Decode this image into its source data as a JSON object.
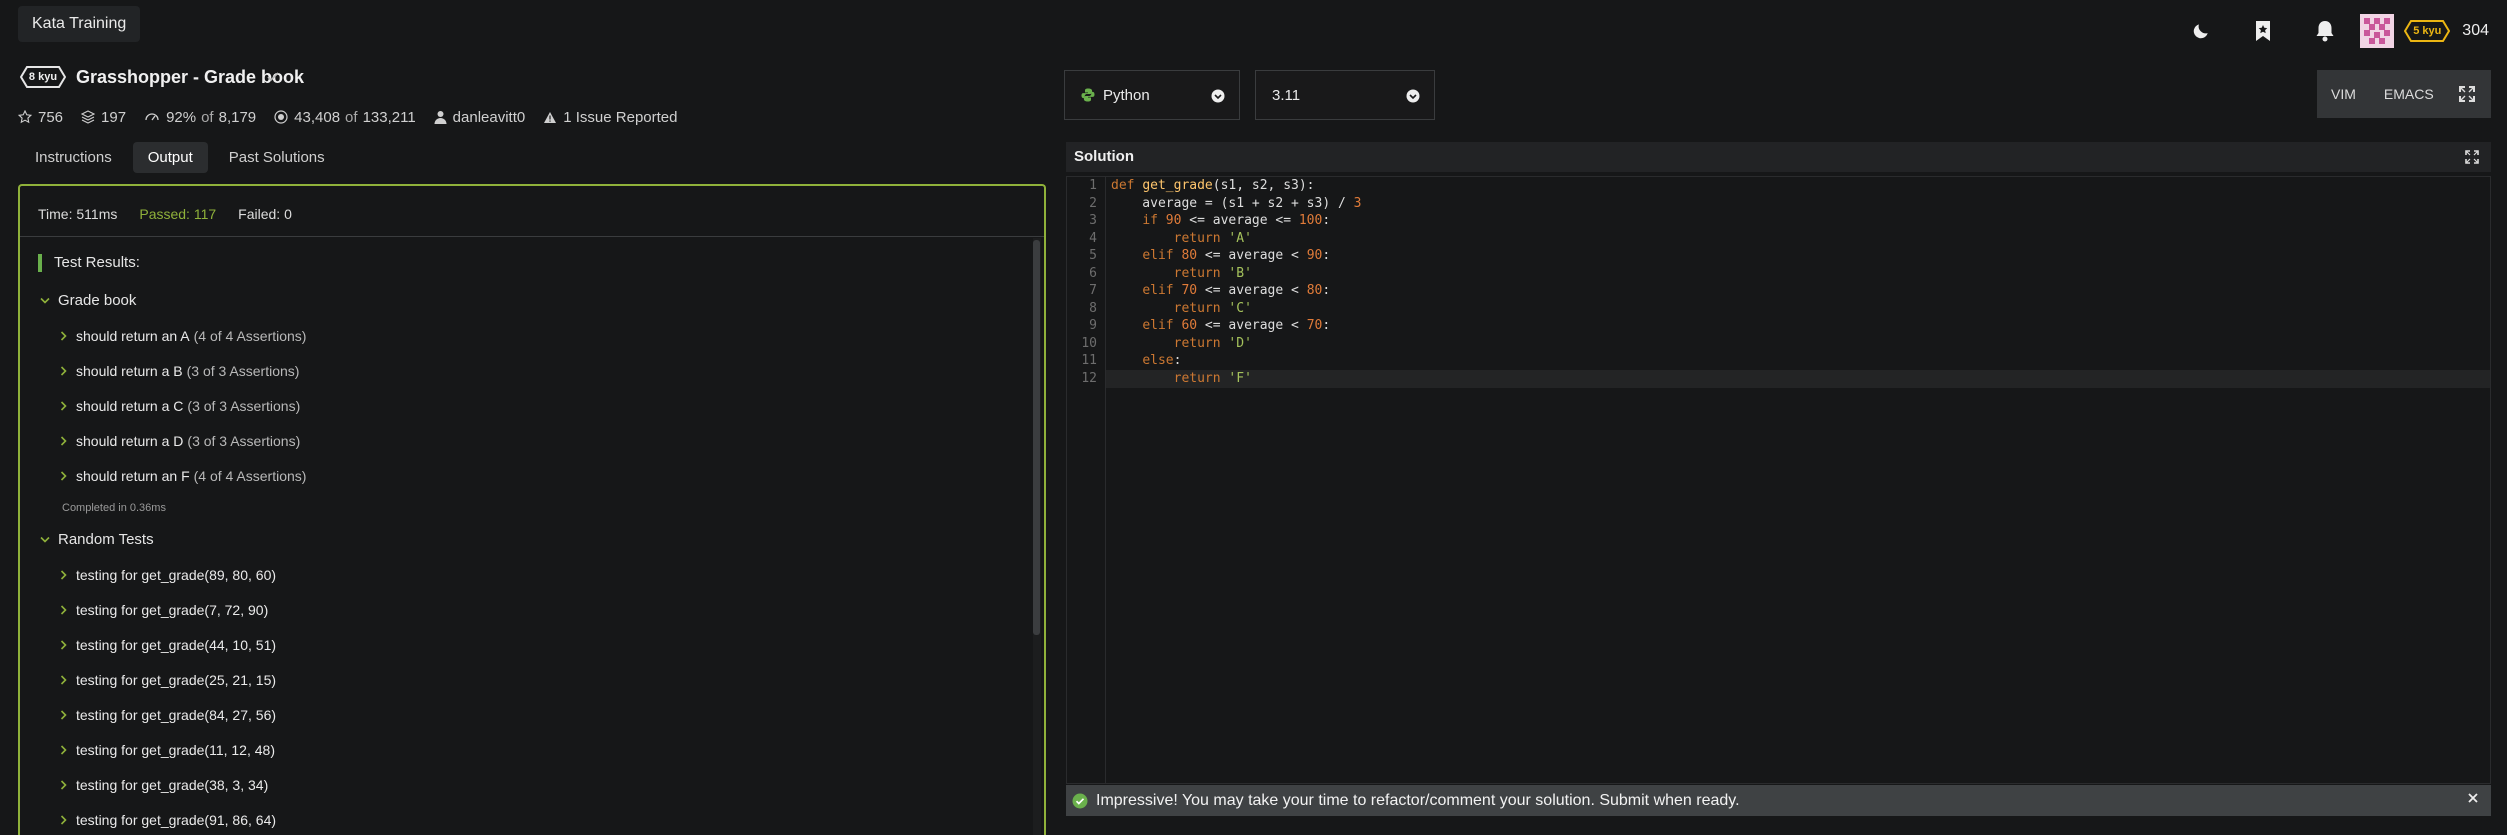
{
  "topbar": {
    "brand": "Kata Training",
    "rank": "5 kyu",
    "honor": "304",
    "colors": {
      "rank_badge": "#ecb613"
    }
  },
  "kata": {
    "kyu": "8 kyu",
    "title": "Grasshopper - Grade book",
    "stats": {
      "stars": "756",
      "collections": "197",
      "satisfaction": "92%",
      "of": "of",
      "votes": "8,179",
      "completed": "43,408",
      "attempts": "133,211",
      "author": "danleavitt0",
      "issues": "1 Issue Reported"
    }
  },
  "tabs": [
    {
      "label": "Instructions"
    },
    {
      "label": "Output"
    },
    {
      "label": "Past Solutions"
    }
  ],
  "output": {
    "time": "Time: 511ms",
    "passed": "Passed: 117",
    "failed": "Failed: 0",
    "results_heading": "Test Results:",
    "group1": {
      "title": "Grade book",
      "tests": [
        {
          "name": "should return an A",
          "assertions": "(4 of 4 Assertions)"
        },
        {
          "name": "should return a B",
          "assertions": "(3 of 3 Assertions)"
        },
        {
          "name": "should return a C",
          "assertions": "(3 of 3 Assertions)"
        },
        {
          "name": "should return a D",
          "assertions": "(3 of 3 Assertions)"
        },
        {
          "name": "should return an F",
          "assertions": "(4 of 4 Assertions)"
        }
      ],
      "completed": "Completed in 0.36ms"
    },
    "group2": {
      "title": "Random Tests",
      "tests": [
        "testing for get_grade(89, 80, 60)",
        "testing for get_grade(7, 72, 90)",
        "testing for get_grade(44, 10, 51)",
        "testing for get_grade(25, 21, 15)",
        "testing for get_grade(84, 27, 56)",
        "testing for get_grade(11, 12, 48)",
        "testing for get_grade(38, 3, 34)",
        "testing for get_grade(91, 86, 64)"
      ]
    }
  },
  "editor": {
    "language": "Python",
    "version": "3.11",
    "modes": [
      "VIM",
      "EMACS"
    ],
    "solution_title": "Solution",
    "line_numbers": [
      "1",
      "2",
      "3",
      "4",
      "5",
      "6",
      "7",
      "8",
      "9",
      "10",
      "11",
      "12"
    ],
    "code": {
      "l1_kw": "def",
      "l1_fn": "get_grade",
      "l1_rest": "(s1, s2, s3):",
      "l2": "    average = (s1 + s2 + s3) / ",
      "l2_num": "3",
      "l3_kw": "if",
      "l3_num": "90",
      "l3_rest": " <= average <= ",
      "l3_num2": "100",
      "l3_end": ":",
      "l4_kw": "return",
      "l4_str": "'A'",
      "l5_kw": "elif",
      "l5_num": "80",
      "l5_rest": " <= average < ",
      "l5_num2": "90",
      "l5_end": ":",
      "l6_kw": "return",
      "l6_str": "'B'",
      "l7_kw": "elif",
      "l7_num": "70",
      "l7_rest": " <= average < ",
      "l7_num2": "80",
      "l7_end": ":",
      "l8_kw": "return",
      "l8_str": "'C'",
      "l9_kw": "elif",
      "l9_num": "60",
      "l9_rest": " <= average < ",
      "l9_num2": "70",
      "l9_end": ":",
      "l10_kw": "return",
      "l10_str": "'D'",
      "l11_kw": "else",
      "l11_end": ":",
      "l12_kw": "return",
      "l12_str": "'F'"
    }
  },
  "notice": {
    "text": "Impressive! You may take your time to refactor/comment your solution. Submit when ready."
  }
}
